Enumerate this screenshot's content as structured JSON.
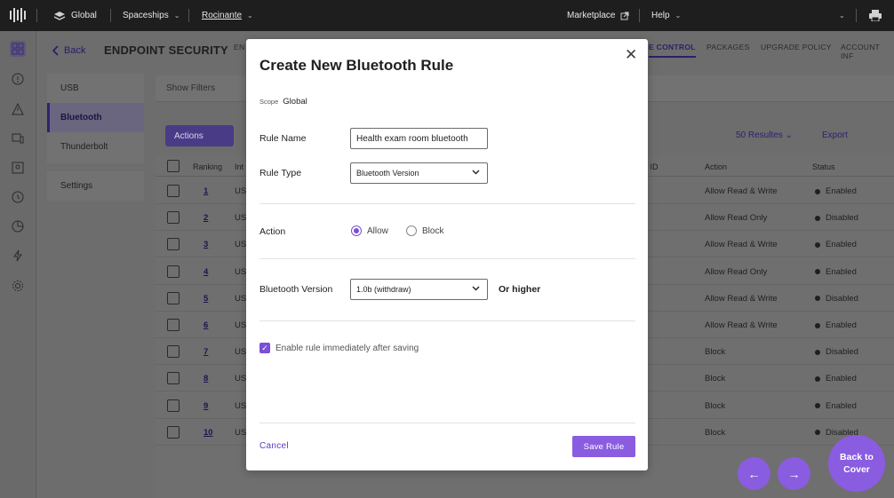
{
  "topbar": {
    "scope": "Global",
    "project": "Spaceships",
    "ship": "Rocinante",
    "marketplace": "Marketplace",
    "help": "Help"
  },
  "page": {
    "back": "Back",
    "title": "ENDPOINT SECURITY",
    "tabs": [
      "EN",
      "E CONTROL",
      "PACKAGES",
      "UPGRADE POLICY",
      "ACCOUNT INF"
    ]
  },
  "subnav": {
    "items": [
      "USB",
      "Bluetooth",
      "Thunderbolt"
    ],
    "settings": "Settings"
  },
  "filter": {
    "show_filters": "Show Filters"
  },
  "toolbar": {
    "actions": "Actions",
    "results": "50 Resultes",
    "export": "Export"
  },
  "table": {
    "headers": {
      "ranking": "Ranking",
      "interface": "Int",
      "id": "l ID",
      "action": "Action",
      "status": "Status"
    },
    "rows": [
      {
        "rank": "1",
        "type": "US",
        "action": "Allow Read & Write",
        "status": "Enabled"
      },
      {
        "rank": "2",
        "type": "US",
        "action": "Allow Read Only",
        "status": "Disabled"
      },
      {
        "rank": "3",
        "type": "US",
        "action": "Allow Read & Write",
        "status": "Enabled"
      },
      {
        "rank": "4",
        "type": "US",
        "action": "Allow Read Only",
        "status": "Enabled"
      },
      {
        "rank": "5",
        "type": "US",
        "action": "Allow Read & Write",
        "status": "Disabled"
      },
      {
        "rank": "6",
        "type": "US",
        "action": "Allow Read & Write",
        "status": "Enabled"
      },
      {
        "rank": "7",
        "type": "US",
        "action": "Block",
        "status": "Disabled"
      },
      {
        "rank": "8",
        "type": "US",
        "action": "Block",
        "status": "Enabled"
      },
      {
        "rank": "9",
        "type": "US",
        "action": "Block",
        "status": "Enabled"
      },
      {
        "rank": "10",
        "type": "US",
        "action": "Block",
        "status": "Disabled"
      }
    ]
  },
  "nav_buttons": {
    "prev": "←",
    "next": "→",
    "back_to_cover": "Back to Cover"
  },
  "modal": {
    "title": "Create New Bluetooth Rule",
    "scope_label": "Scope",
    "scope_value": "Global",
    "rule_name_label": "Rule Name",
    "rule_name_value": "Health exam room bluetooth",
    "rule_type_label": "Rule Type",
    "rule_type_value": "Bluetooth Version",
    "action_label": "Action",
    "action_options": [
      "Allow",
      "Block"
    ],
    "action_selected": "Allow",
    "bt_version_label": "Bluetooth Version",
    "bt_version_value": "1.0b (withdraw)",
    "or_higher": "Or higher",
    "enable_label": "Enable rule immediately after saving",
    "enable_checked": true,
    "cancel": "Cancel",
    "save": "Save Rule"
  },
  "colors": {
    "accent": "#8a5ce0",
    "topbar": "#1e1e1e",
    "overlay": "#6e6e6e"
  }
}
